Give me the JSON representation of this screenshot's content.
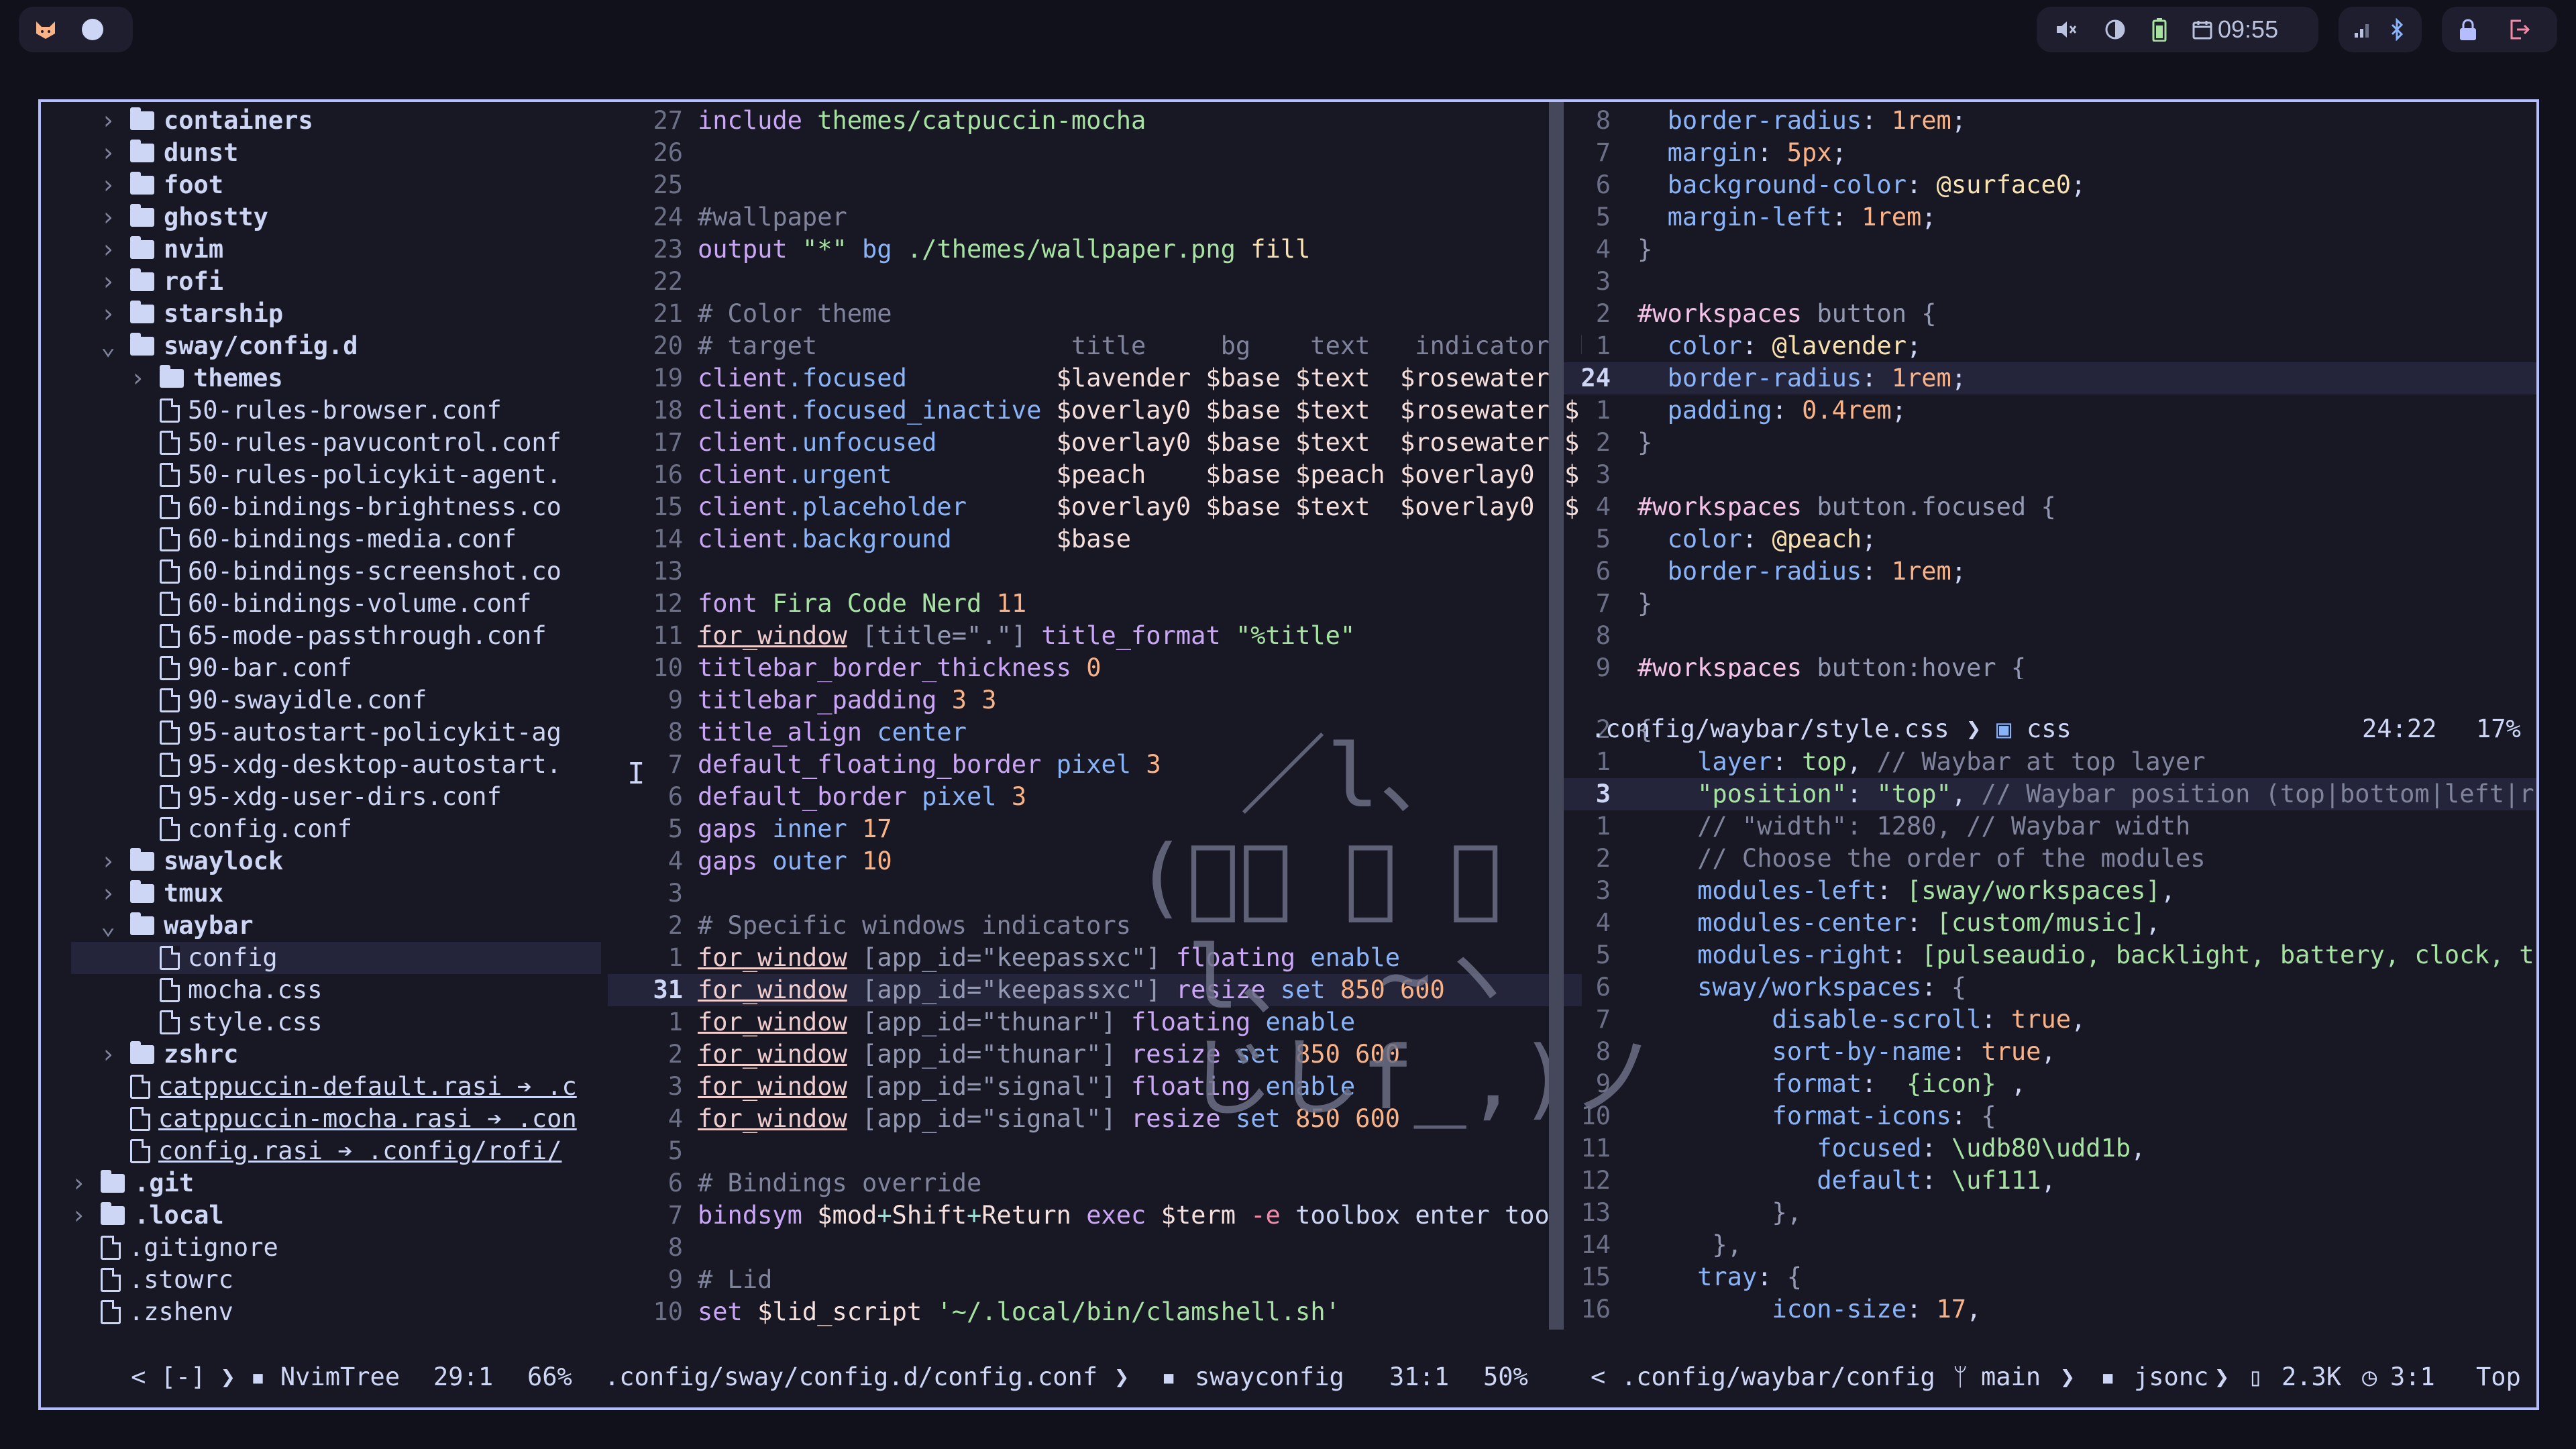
{
  "topbar": {
    "clock": "09:55"
  },
  "tree": {
    "items": [
      {
        "indent": 1,
        "type": "dir-closed",
        "name": "containers"
      },
      {
        "indent": 1,
        "type": "dir-closed",
        "name": "dunst"
      },
      {
        "indent": 1,
        "type": "dir-closed",
        "name": "foot"
      },
      {
        "indent": 1,
        "type": "dir-closed",
        "name": "ghostty"
      },
      {
        "indent": 1,
        "type": "dir-closed",
        "name": "nvim"
      },
      {
        "indent": 1,
        "type": "dir-closed",
        "name": "rofi"
      },
      {
        "indent": 1,
        "type": "dir-closed",
        "name": "starship"
      },
      {
        "indent": 1,
        "type": "dir-open",
        "name": "sway/config.d"
      },
      {
        "indent": 2,
        "type": "dir-closed",
        "name": "themes"
      },
      {
        "indent": 2,
        "type": "file",
        "name": "50-rules-browser.conf"
      },
      {
        "indent": 2,
        "type": "file",
        "name": "50-rules-pavucontrol.conf"
      },
      {
        "indent": 2,
        "type": "file",
        "name": "50-rules-policykit-agent."
      },
      {
        "indent": 2,
        "type": "file",
        "name": "60-bindings-brightness.co"
      },
      {
        "indent": 2,
        "type": "file",
        "name": "60-bindings-media.conf"
      },
      {
        "indent": 2,
        "type": "file",
        "name": "60-bindings-screenshot.co"
      },
      {
        "indent": 2,
        "type": "file",
        "name": "60-bindings-volume.conf"
      },
      {
        "indent": 2,
        "type": "file",
        "name": "65-mode-passthrough.conf"
      },
      {
        "indent": 2,
        "type": "file",
        "name": "90-bar.conf"
      },
      {
        "indent": 2,
        "type": "file",
        "name": "90-swayidle.conf"
      },
      {
        "indent": 2,
        "type": "file",
        "name": "95-autostart-policykit-ag"
      },
      {
        "indent": 2,
        "type": "file",
        "name": "95-xdg-desktop-autostart."
      },
      {
        "indent": 2,
        "type": "file",
        "name": "95-xdg-user-dirs.conf"
      },
      {
        "indent": 2,
        "type": "file",
        "name": "config.conf"
      },
      {
        "indent": 1,
        "type": "dir-closed",
        "name": "swaylock"
      },
      {
        "indent": 1,
        "type": "dir-closed",
        "name": "tmux"
      },
      {
        "indent": 1,
        "type": "dir-open",
        "name": "waybar"
      },
      {
        "indent": 2,
        "type": "file",
        "name": "config",
        "selected": true
      },
      {
        "indent": 2,
        "type": "file",
        "name": "mocha.css"
      },
      {
        "indent": 2,
        "type": "file",
        "name": "style.css"
      },
      {
        "indent": 1,
        "type": "dir-closed",
        "name": "zshrc"
      },
      {
        "indent": 1,
        "type": "link",
        "name": "catppuccin-default.rasi ➔ .c"
      },
      {
        "indent": 1,
        "type": "link",
        "name": "catppuccin-mocha.rasi ➔ .con"
      },
      {
        "indent": 1,
        "type": "link",
        "name": "config.rasi ➔ .config/rofi/"
      },
      {
        "indent": 0,
        "type": "dir-closed",
        "name": ".git"
      },
      {
        "indent": 0,
        "type": "dir-closed",
        "name": ".local"
      },
      {
        "indent": 0,
        "type": "file",
        "name": ".gitignore"
      },
      {
        "indent": 0,
        "type": "file",
        "name": ".stowrc"
      },
      {
        "indent": 0,
        "type": "file",
        "name": ".zshenv"
      }
    ],
    "status": {
      "left": "< [-] ",
      "name": "NvimTree",
      "pos": "29:1",
      "pct": "66%"
    }
  },
  "sway": {
    "lines": [
      {
        "n": "27",
        "html": "<span class='kw'>include</span> <span class='str'>themes/catpuccin-mocha</span>"
      },
      {
        "n": "26",
        "html": ""
      },
      {
        "n": "25",
        "html": ""
      },
      {
        "n": "24",
        "html": "<span class='cmt'>#wallpaper</span>"
      },
      {
        "n": "23",
        "html": "<span class='kw'>output</span> <span class='str'>\"*\"</span> <span class='prop'>bg</span> <span class='str'>./themes/wallpaper.png</span> <span class='yel'>fill</span>"
      },
      {
        "n": "22",
        "html": ""
      },
      {
        "n": "21",
        "html": "<span class='cmt'># Color theme</span>"
      },
      {
        "n": "20",
        "html": "<span class='cmt'># target                 title     bg    text   indicator  b</span>"
      },
      {
        "n": "19",
        "html": "<span class='kw'>client</span><span class='prop'>.focused</span>          <span class='var'>$lavender $base $text  $rosewater $</span>"
      },
      {
        "n": "18",
        "html": "<span class='kw'>client</span><span class='prop'>.focused_inactive</span> <span class='var'>$overlay0 $base $text  $rosewater $</span>"
      },
      {
        "n": "17",
        "html": "<span class='kw'>client</span><span class='prop'>.unfocused</span>        <span class='var'>$overlay0 $base $text  $rosewater $</span>"
      },
      {
        "n": "16",
        "html": "<span class='kw'>client</span><span class='prop'>.urgent</span>           <span class='var'>$peach    $base $peach $overlay0  $</span>"
      },
      {
        "n": "15",
        "html": "<span class='kw'>client</span><span class='prop'>.placeholder</span>      <span class='var'>$overlay0 $base $text  $overlay0  $</span>"
      },
      {
        "n": "14",
        "html": "<span class='kw'>client</span><span class='prop'>.background</span>       <span class='var'>$base</span>"
      },
      {
        "n": "13",
        "html": ""
      },
      {
        "n": "12",
        "html": "<span class='kw'>font</span> <span class='str'>Fira Code Nerd</span> <span class='numv'>11</span>"
      },
      {
        "n": "11",
        "html": "<span class='und'>for_window</span> <span class='gray'>[title=\".\"]</span> <span class='kw'>title_format</span> <span class='str'>\"%title\"</span>"
      },
      {
        "n": "10",
        "html": "<span class='kw'>titlebar_border_thickness</span> <span class='numv'>0</span>"
      },
      {
        "n": "9",
        "html": "<span class='kw'>titlebar_padding</span> <span class='numv'>3 3</span>"
      },
      {
        "n": "8",
        "html": "<span class='kw'>title_align</span> <span class='prop'>center</span>"
      },
      {
        "n": "7",
        "html": "<span class='kw'>default_floating_border</span> <span class='prop'>pixel</span> <span class='numv'>3</span>"
      },
      {
        "n": "6",
        "html": "<span class='kw'>default_border</span> <span class='prop'>pixel</span> <span class='numv'>3</span>"
      },
      {
        "n": "5",
        "html": "<span class='kw'>gaps</span> <span class='prop'>inner</span> <span class='numv'>17</span>"
      },
      {
        "n": "4",
        "html": "<span class='kw'>gaps</span> <span class='prop'>outer</span> <span class='numv'>10</span>"
      },
      {
        "n": "3",
        "html": ""
      },
      {
        "n": "2",
        "html": "<span class='cmt'># Specific windows indicators</span>"
      },
      {
        "n": "1",
        "html": "<span class='und'>for_window</span> <span class='gray'>[app_id=\"keepassxc\"]</span> <span class='kw'>floating</span> <span class='prop'>enable</span>"
      },
      {
        "n": "31",
        "html": "<span class='und'>for_window</span> <span class='gray'>[app_id=\"keepassxc\"]</span> <span class='kw'>resize</span> <span class='prop'>set</span> <span class='numv'>850 600</span>",
        "current": true
      },
      {
        "n": "1",
        "html": "<span class='und'>for_window</span> <span class='gray'>[app_id=\"thunar\"]</span> <span class='kw'>floating</span> <span class='prop'>enable</span>"
      },
      {
        "n": "2",
        "html": "<span class='und'>for_window</span> <span class='gray'>[app_id=\"thunar\"]</span> <span class='kw'>resize</span> <span class='prop'>set</span> <span class='numv'>850 600</span>"
      },
      {
        "n": "3",
        "html": "<span class='und'>for_window</span> <span class='gray'>[app_id=\"signal\"]</span> <span class='kw'>floating</span> <span class='prop'>enable</span>"
      },
      {
        "n": "4",
        "html": "<span class='und'>for_window</span> <span class='gray'>[app_id=\"signal\"]</span> <span class='kw'>resize</span> <span class='prop'>set</span> <span class='numv'>850 600</span>"
      },
      {
        "n": "5",
        "html": ""
      },
      {
        "n": "6",
        "html": "<span class='cmt'># Bindings override</span>"
      },
      {
        "n": "7",
        "html": "<span class='kw'>bindsym</span> <span class='var'>$mod</span><span class='op'>+</span><span class='var'>Shift</span><span class='op'>+</span><span class='var'>Return</span> <span class='kw'>exec</span> <span class='var'>$term</span> <span class='red'>-e</span> toolbox enter tool"
      },
      {
        "n": "8",
        "html": ""
      },
      {
        "n": "9",
        "html": "<span class='cmt'># Lid</span>"
      },
      {
        "n": "10",
        "html": "<span class='kw'>set</span> <span class='var'>$lid_script</span> <span class='str'>'~/.local/bin/clamshell.sh'</span>"
      }
    ],
    "status": {
      "path": ".config/sway/config.d/config.conf",
      "ft": "swayconfig",
      "pos": "31:1",
      "pct": "50%"
    }
  },
  "css": {
    "lines": [
      {
        "n": "8",
        "html": "  <span class='prop'>border-radius</span>: <span class='numv'>1rem</span>;"
      },
      {
        "n": "7",
        "html": "  <span class='prop'>margin</span>: <span class='numv'>5px</span>;"
      },
      {
        "n": "6",
        "html": "  <span class='prop'>background-color</span>: <span class='yel'>@surface0</span>;"
      },
      {
        "n": "5",
        "html": "  <span class='prop'>margin-left</span>: <span class='numv'>1rem</span>;"
      },
      {
        "n": "4",
        "html": "<span class='gray'>}</span>"
      },
      {
        "n": "3",
        "html": ""
      },
      {
        "n": "2",
        "html": "<span class='pink'>#workspaces</span> <span class='gray'>button {</span>"
      },
      {
        "n": "1",
        "html": "  <span class='prop'>color</span>: <span class='yel'>@lavender</span>;"
      },
      {
        "n": "24",
        "html": "  <span class='prop'>border-radius</span>: <span class='numv'>1rem</span>;",
        "current": true
      },
      {
        "n": "1",
        "html": "  <span class='prop'>padding</span>: <span class='numv'>0.4rem</span>;"
      },
      {
        "n": "2",
        "html": "<span class='gray'>}</span>"
      },
      {
        "n": "3",
        "html": ""
      },
      {
        "n": "4",
        "html": "<span class='pink'>#workspaces</span> <span class='gray'>button.focused {</span>"
      },
      {
        "n": "5",
        "html": "  <span class='prop'>color</span>: <span class='yel'>@peach</span>;"
      },
      {
        "n": "6",
        "html": "  <span class='prop'>border-radius</span>: <span class='numv'>1rem</span>;"
      },
      {
        "n": "7",
        "html": "<span class='gray'>}</span>"
      },
      {
        "n": "8",
        "html": ""
      },
      {
        "n": "9",
        "html": "<span class='pink'>#workspaces</span> <span class='gray'>button:hover {</span>"
      }
    ],
    "status": {
      "path": ".config/waybar/style.css",
      "ft": "css",
      "pos": "24:22",
      "pct": "17%"
    }
  },
  "jsonc": {
    "lines": [
      {
        "n": "2",
        "html": "<span class='gray'>{</span>"
      },
      {
        "n": "1",
        "html": "    <span class='prop'>layer</span>: <span class='green'>top</span>, <span class='cmt'>// Waybar at top layer</span>"
      },
      {
        "n": "3",
        "html": "    <span class='str'>\"position\"</span>: <span class='str'>\"top\"</span>, <span class='cmt'>// Waybar position (top|bottom|left|r</span>",
        "current": true
      },
      {
        "n": "1",
        "html": "    <span class='cmt'>// \"width\": 1280, // Waybar width</span>"
      },
      {
        "n": "2",
        "html": "    <span class='cmt'>// Choose the order of the modules</span>"
      },
      {
        "n": "3",
        "html": "    <span class='prop'>modules-left</span>: <span class='green'>[sway/workspaces]</span>,"
      },
      {
        "n": "4",
        "html": "    <span class='prop'>modules-center</span>: <span class='green'>[custom/music]</span>,"
      },
      {
        "n": "5",
        "html": "    <span class='prop'>modules-right</span>: <span class='green'>[pulseaudio, backlight, battery, clock, t</span>"
      },
      {
        "n": "6",
        "html": "    <span class='prop'>sway/workspaces</span>: <span class='gray'>{</span>"
      },
      {
        "n": "7",
        "html": "         <span class='prop'>disable-scroll</span>: <span class='numv'>true</span>,"
      },
      {
        "n": "8",
        "html": "         <span class='prop'>sort-by-name</span>: <span class='numv'>true</span>,"
      },
      {
        "n": "9",
        "html": "         <span class='prop'>format</span>:  <span class='green'>{icon}</span> ,"
      },
      {
        "n": "10",
        "html": "         <span class='prop'>format-icons</span>: <span class='gray'>{</span>"
      },
      {
        "n": "11",
        "html": "            <span class='prop'>focused</span>: <span class='green'>\\udb80\\udd1b</span>,"
      },
      {
        "n": "12",
        "html": "            <span class='prop'>default</span>: <span class='green'>\\uf111</span>,"
      },
      {
        "n": "13",
        "html": "         <span class='gray'>},</span>"
      },
      {
        "n": "14",
        "html": "     <span class='gray'>},</span>"
      },
      {
        "n": "15",
        "html": "    <span class='prop'>tray</span>: <span class='gray'>{</span>"
      },
      {
        "n": "16",
        "html": "         <span class='prop'>icon-size</span>: <span class='numv'>17</span>,"
      }
    ],
    "status": {
      "left": "<",
      "path": ".config/waybar/config",
      "branch": "main",
      "ft": "jsonc",
      "size": "2.3K",
      "pos": "3:1",
      "pct": "Top"
    }
  },
  "colors": {
    "border_active": "#b4befe",
    "background": "#181825",
    "desktop": "#11111b"
  }
}
